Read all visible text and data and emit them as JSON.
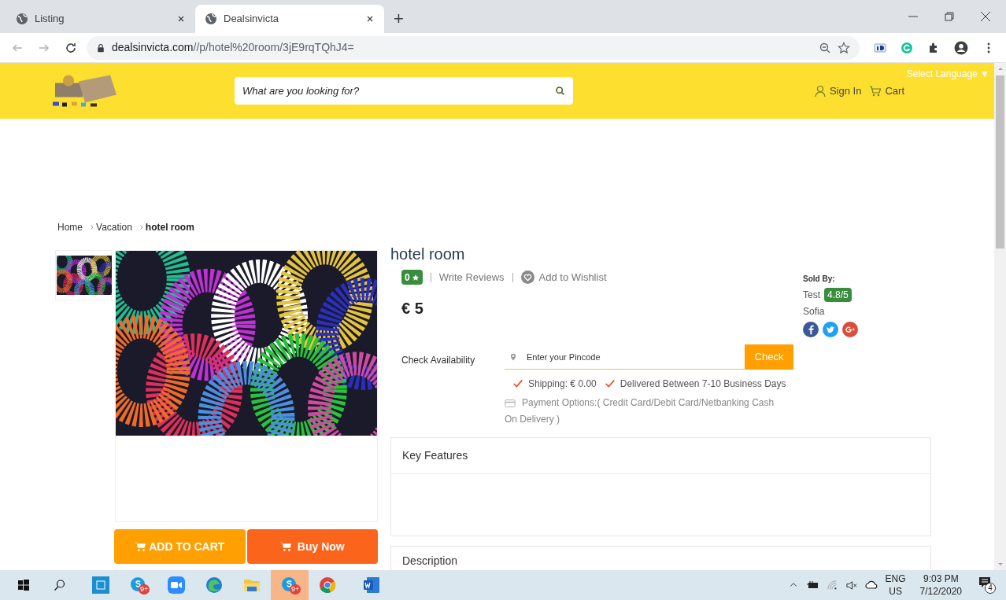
{
  "browser": {
    "tabs": [
      {
        "title": "Listing",
        "selected": false
      },
      {
        "title": "Dealsinvicta",
        "selected": true
      }
    ],
    "new_tab": "+",
    "url_host": "dealsinvicta.com",
    "url_path": "//p/hotel%20room/3jE9rqTQhJ4="
  },
  "header": {
    "search_placeholder": "What are you looking for?",
    "select_language": "Select Language ▼",
    "sign_in": "Sign In",
    "cart": "Cart"
  },
  "breadcrumb": [
    {
      "label": "Home",
      "current": false
    },
    {
      "label": "Vacation",
      "current": false
    },
    {
      "label": "hotel room",
      "current": true
    }
  ],
  "product": {
    "title": "hotel room",
    "rating": "0",
    "write_reviews": "Write Reviews",
    "wishlist": "Add to Wishlist",
    "price": "€ 5",
    "check_label": "Check Availability",
    "pincode_placeholder": "Enter your Pincode",
    "check_button": "Check",
    "shipping": "Shipping: € 0.00",
    "delivery": "Delivered Between 7-10 Business Days",
    "payment": "Payment Options:( Credit Card/Debit Card/Netbanking Cash On Delivery )",
    "sold_by_label": "Sold By:",
    "seller": "Test",
    "seller_rating": "4.8/5",
    "seller_city": "Sofia",
    "add_to_cart": "ADD TO CART",
    "buy_now": "Buy Now",
    "sections": [
      "Key Features",
      "Description"
    ]
  },
  "taskbar": {
    "apps": [
      {
        "kind": "store",
        "selected": false
      },
      {
        "kind": "skype",
        "badge": "9+",
        "selected": false
      },
      {
        "kind": "zoom",
        "selected": false
      },
      {
        "kind": "edge",
        "selected": false
      },
      {
        "kind": "folder",
        "selected": false
      },
      {
        "kind": "skype",
        "badge": "9+",
        "selected": true
      },
      {
        "kind": "chrome",
        "selected": false
      },
      {
        "kind": "word",
        "selected": false
      }
    ],
    "lang": "ENG",
    "region": "US",
    "time": "9:03 PM",
    "date": "7/12/2020",
    "notifications": "4"
  }
}
